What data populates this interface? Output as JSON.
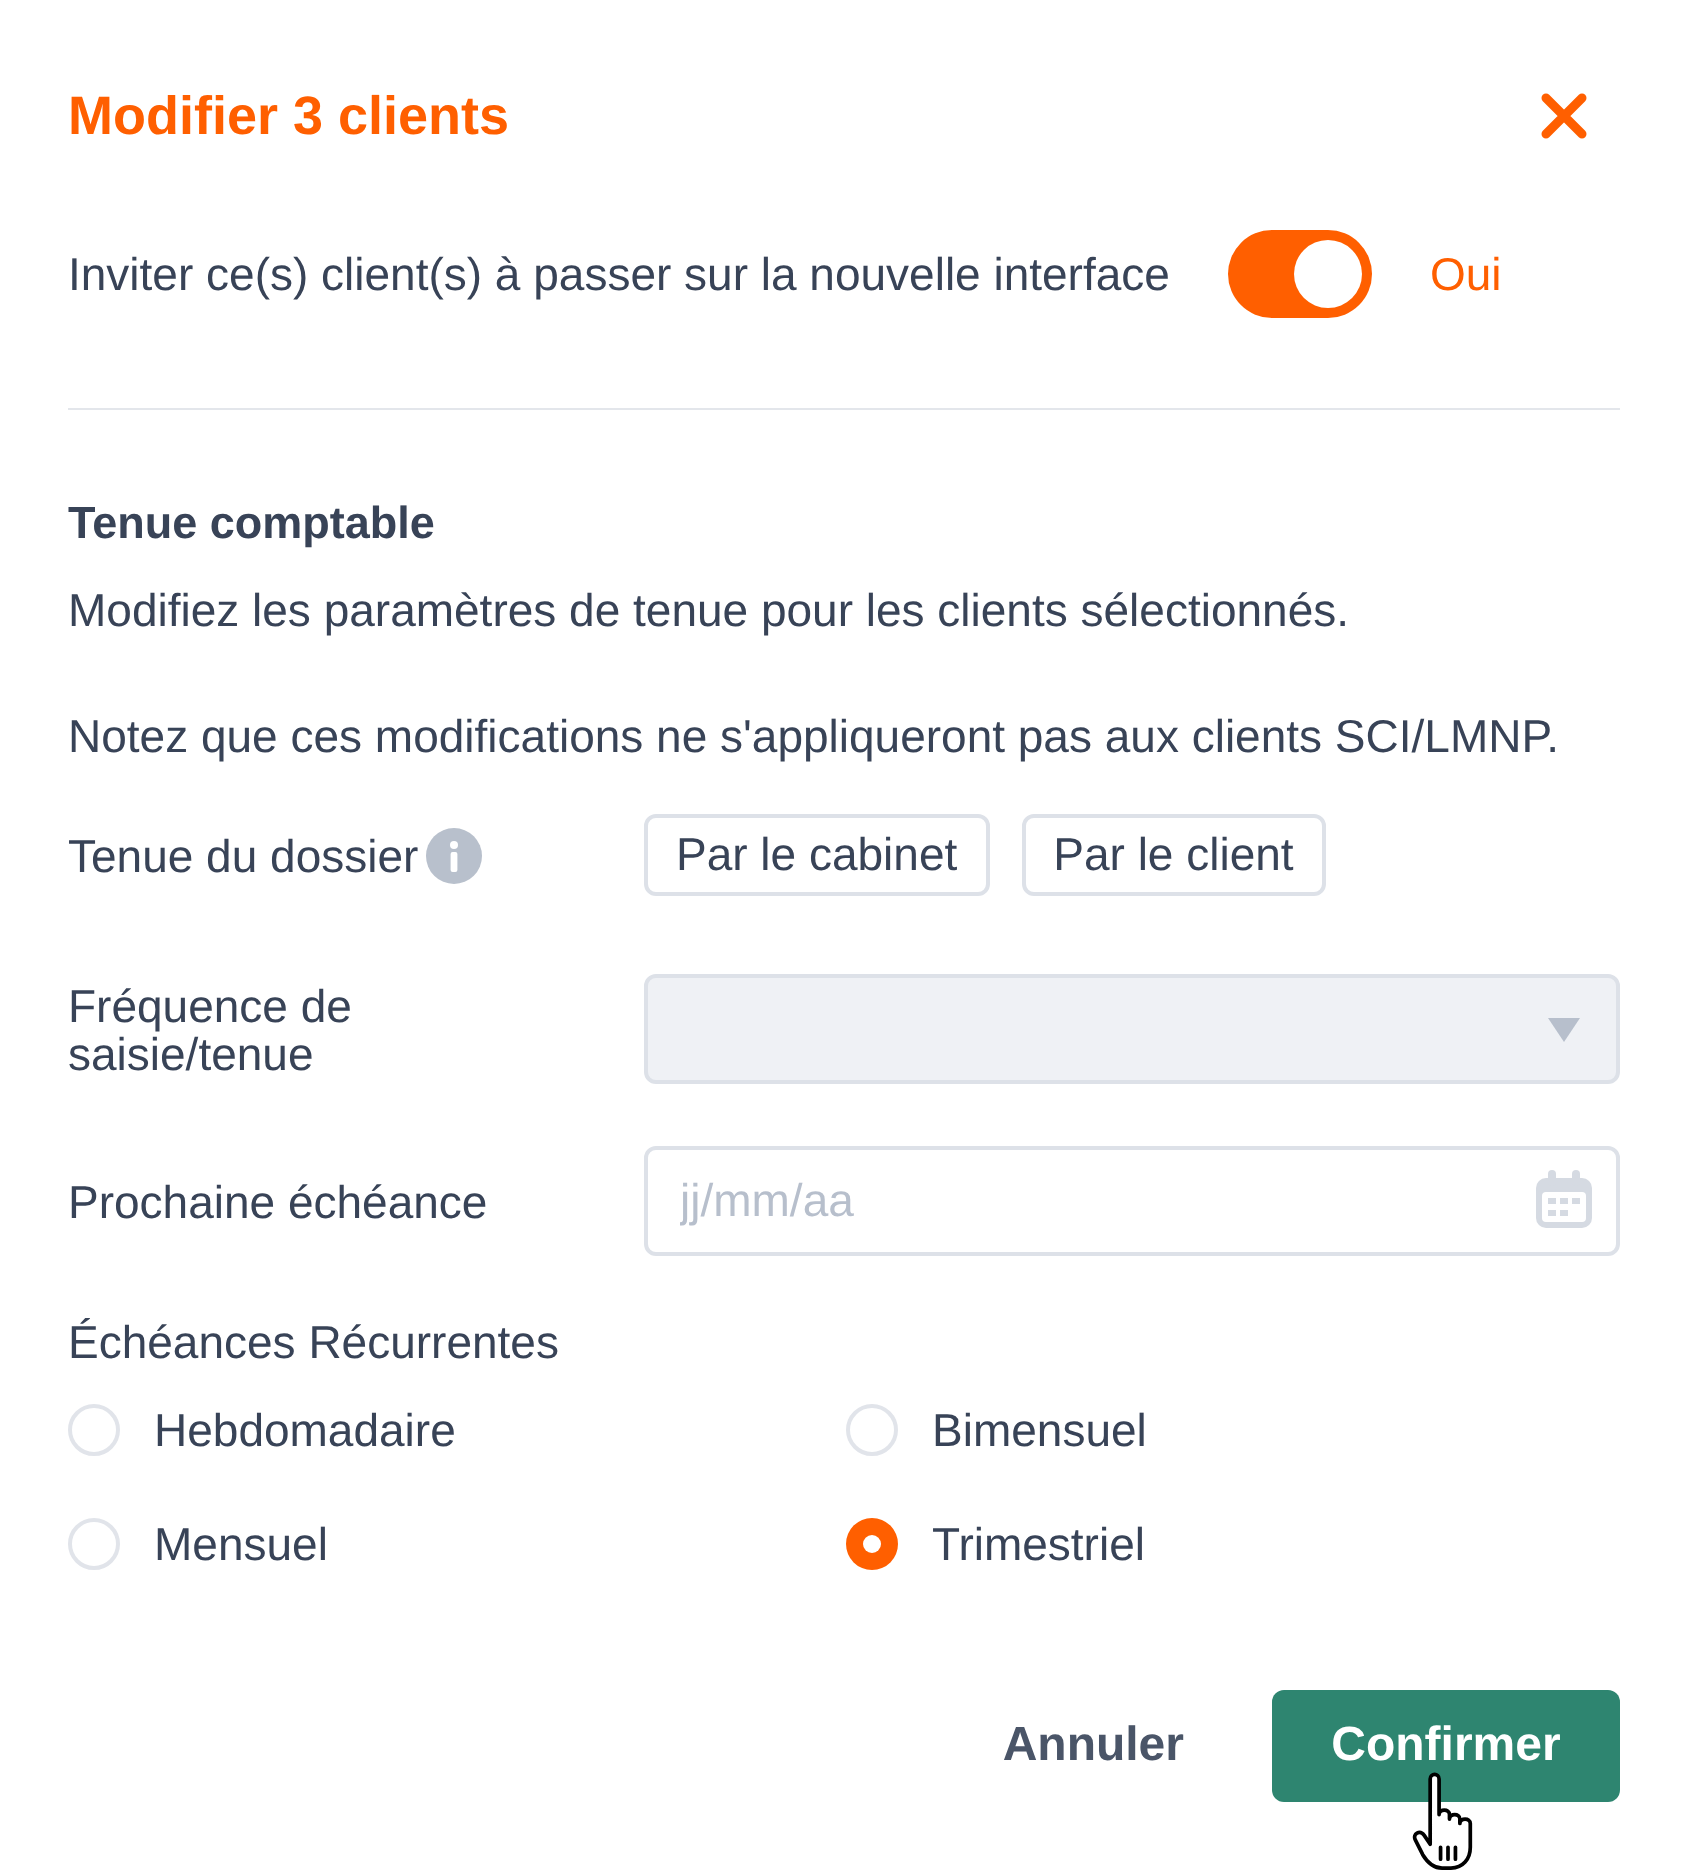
{
  "dialog": {
    "title": "Modifier 3 clients"
  },
  "invite": {
    "label": "Inviter ce(s) client(s) à passer sur la nouvelle interface",
    "on": true,
    "state_label": "Oui"
  },
  "section": {
    "title": "Tenue comptable",
    "paragraphs": [
      "Modifiez les paramètres de tenue pour les clients sélectionnés.",
      "Notez que ces modifications ne s'appliqueront pas aux clients SCI/LMNP."
    ]
  },
  "fields": [
    {
      "kind": "choice",
      "label": "Tenue du dossier",
      "info": true,
      "options": [
        {
          "label": "Par le cabinet",
          "selected": false
        },
        {
          "label": "Par le client",
          "selected": false
        }
      ]
    },
    {
      "kind": "select",
      "label": "Fréquence de saisie/tenue",
      "disabled": true
    },
    {
      "kind": "date",
      "label": "Prochaine échéance",
      "placeholder": "jj/mm/aa"
    }
  ],
  "recurrence": {
    "label": "Échéances Récurrentes",
    "options": [
      {
        "label": "Hebdomadaire",
        "selected": false
      },
      {
        "label": "Bimensuel",
        "selected": false
      },
      {
        "label": "Mensuel",
        "selected": false
      },
      {
        "label": "Trimestriel",
        "selected": true
      }
    ]
  },
  "actions": {
    "cancel": "Annuler",
    "confirm": "Confirmer"
  }
}
